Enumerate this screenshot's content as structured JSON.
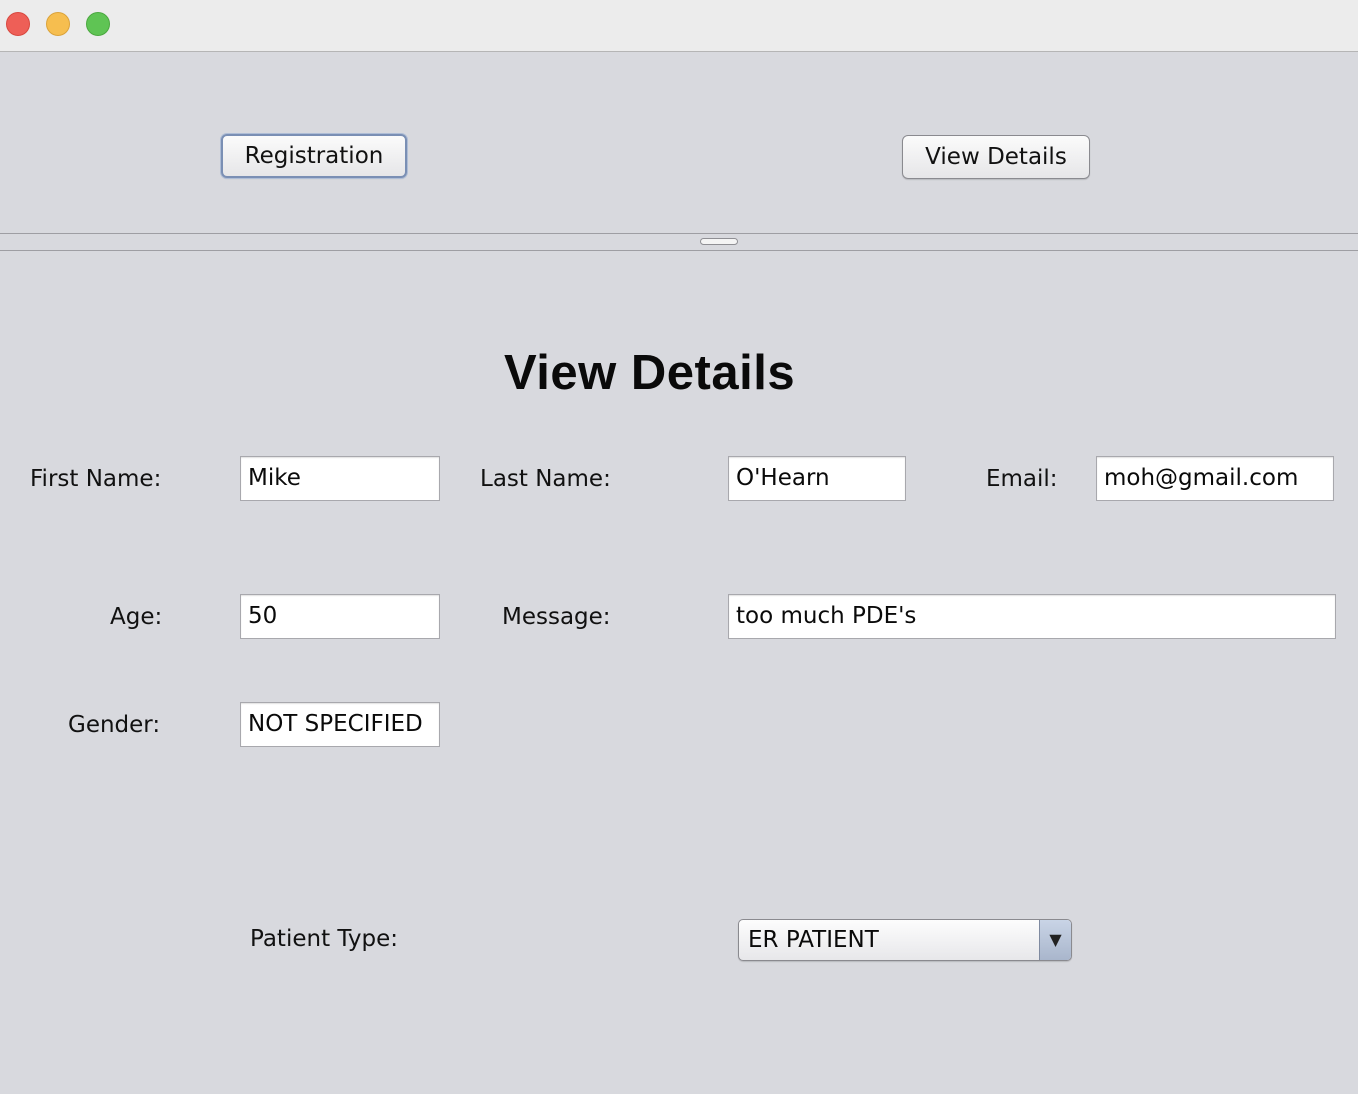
{
  "window": {
    "controls": {
      "close": "close",
      "minimize": "minimize",
      "maximize": "maximize"
    }
  },
  "toolbar": {
    "registration_label": "Registration",
    "view_details_label": "View Details"
  },
  "form": {
    "heading": "View Details",
    "first_name": {
      "label": "First Name:",
      "value": "Mike"
    },
    "last_name": {
      "label": "Last Name:",
      "value": "O'Hearn"
    },
    "email": {
      "label": "Email:",
      "value": "moh@gmail.com"
    },
    "age": {
      "label": "Age:",
      "value": "50"
    },
    "message": {
      "label": "Message:",
      "value": "too much PDE's"
    },
    "gender": {
      "label": "Gender:",
      "value": "NOT SPECIFIED"
    },
    "patient_type": {
      "label": "Patient Type:",
      "selected": "ER PATIENT",
      "arrow": "▼"
    }
  },
  "colors": {
    "background": "#d8d9de",
    "close": "#ee5f57",
    "minimize": "#f6be4f",
    "maximize": "#5fc454",
    "focus_ring": "#7a8fb4"
  }
}
